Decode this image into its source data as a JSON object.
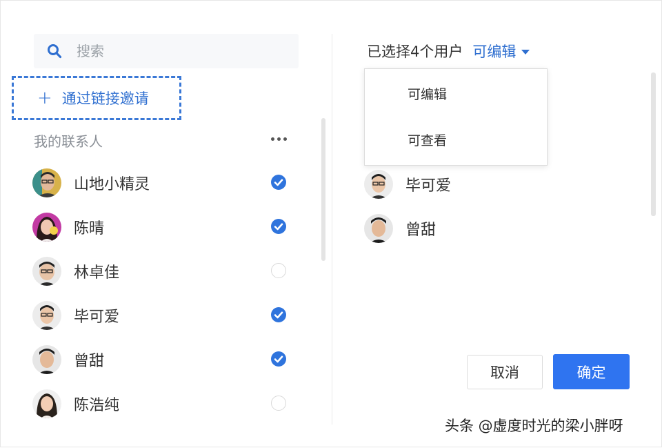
{
  "search": {
    "placeholder": "搜索"
  },
  "invite": {
    "label": "通过链接邀请"
  },
  "contacts": {
    "title": "我的联系人",
    "items": [
      {
        "name": "山地小精灵",
        "checked": true
      },
      {
        "name": "陈晴",
        "checked": true
      },
      {
        "name": "林卓佳",
        "checked": false
      },
      {
        "name": "毕可爱",
        "checked": true
      },
      {
        "name": "曾甜",
        "checked": true
      },
      {
        "name": "陈浩纯",
        "checked": false
      }
    ]
  },
  "selected": {
    "count_text": "已选择4个用户",
    "permission": "可编辑",
    "dropdown_options": [
      "可编辑",
      "可查看"
    ],
    "visible_items": [
      {
        "name": "毕可爱"
      },
      {
        "name": "曾甜"
      }
    ]
  },
  "actions": {
    "cancel": "取消",
    "confirm": "确定"
  },
  "watermark": "头条 @虚度时光的梁小胖呀",
  "colors": {
    "accent": "#2f74f0",
    "link": "#2f6fd0",
    "border": "#dcdcdc"
  }
}
